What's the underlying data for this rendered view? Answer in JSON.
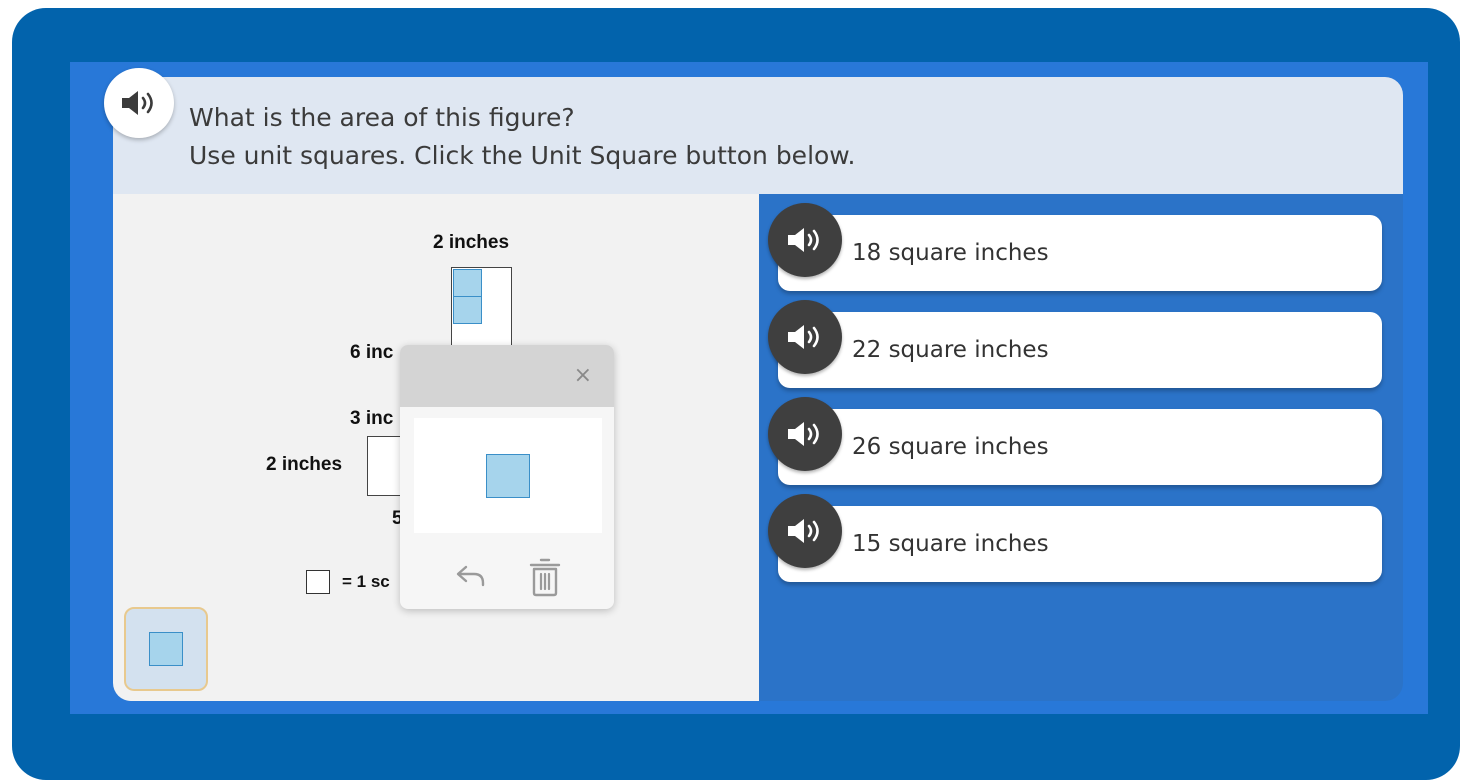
{
  "question": {
    "line1": "What is the area of this figure?",
    "line2": "Use unit squares. Click the Unit Square button below."
  },
  "figure": {
    "label_top": "2 inches",
    "label_left_upper": "6 inc",
    "label_left_middle": "3 inc",
    "label_left_lower": "2 inches",
    "label_bottom": "5",
    "legend_text": "= 1 sc"
  },
  "popup": {
    "close_symbol": "×"
  },
  "answers": [
    {
      "label": "18 square inches"
    },
    {
      "label": "22 square inches"
    },
    {
      "label": "26 square inches"
    },
    {
      "label": "15 square inches"
    }
  ],
  "colors": {
    "frame": "#0263ac",
    "inner_panel": "#2878d8",
    "question_bar": "#dfe7f2",
    "unit_square_fill": "#a6d4ec",
    "unit_square_border": "#3a8fc8",
    "speaker_button": "#3f3f3f"
  },
  "icons": {
    "question_audio": "speaker-icon",
    "answer_audio": "speaker-icon",
    "close": "close-icon",
    "undo": "undo-icon",
    "trash": "trash-icon",
    "unit_square": "unit-square-icon"
  }
}
